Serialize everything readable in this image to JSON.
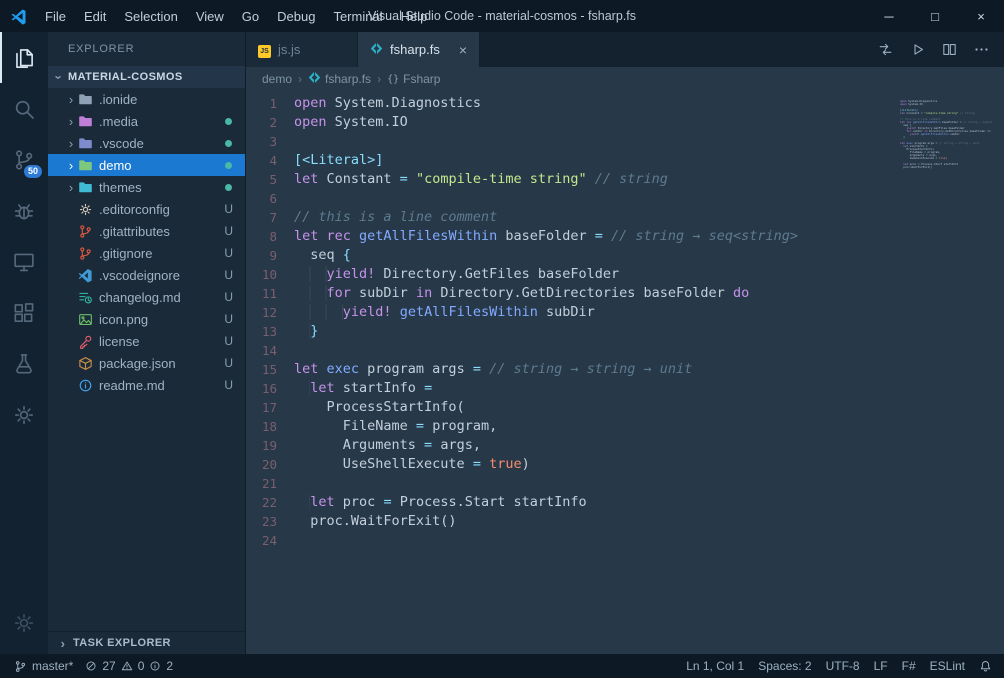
{
  "window": {
    "title": "Visual Studio Code - material-cosmos - fsharp.fs",
    "menus": [
      "File",
      "Edit",
      "Selection",
      "View",
      "Go",
      "Debug",
      "Terminal",
      "Help"
    ],
    "controls": {
      "minimize": "─",
      "maximize": "□",
      "close": "×"
    }
  },
  "activity_bar": {
    "top": [
      {
        "name": "explorer",
        "icon": "files",
        "active": true
      },
      {
        "name": "search",
        "icon": "search"
      },
      {
        "name": "source-control",
        "icon": "scm",
        "badge": "50"
      },
      {
        "name": "debug",
        "icon": "debug"
      },
      {
        "name": "remote-explorer",
        "icon": "remote"
      },
      {
        "name": "extensions",
        "icon": "extensions"
      },
      {
        "name": "test-explorer",
        "icon": "flask"
      },
      {
        "name": "settings",
        "icon": "gear"
      }
    ],
    "bottom": [
      {
        "name": "manage",
        "icon": "gear",
        "dim": true
      }
    ]
  },
  "explorer": {
    "header": "EXPLORER",
    "root": "MATERIAL-COSMOS",
    "bottom_panel": "TASK EXPLORER",
    "items": [
      {
        "kind": "folder",
        "label": ".ionide",
        "color": "#8fa2b5"
      },
      {
        "kind": "folder",
        "label": ".media",
        "color": "#c07fd6",
        "dot": true
      },
      {
        "kind": "folder",
        "label": ".vscode",
        "color": "#7e8ccd",
        "dot": true
      },
      {
        "kind": "folder",
        "label": "demo",
        "color": "#7ec77f",
        "dot": true,
        "selected": true
      },
      {
        "kind": "folder",
        "label": "themes",
        "color": "#3fbcd4",
        "dot": true
      },
      {
        "kind": "file",
        "label": ".editorconfig",
        "icon": "gearfile",
        "color": "#d3cbb7",
        "badge": "U"
      },
      {
        "kind": "file",
        "label": ".gitattributes",
        "icon": "git",
        "color": "#e0593f",
        "badge": "U"
      },
      {
        "kind": "file",
        "label": ".gitignore",
        "icon": "git",
        "color": "#e0593f",
        "badge": "U"
      },
      {
        "kind": "file",
        "label": ".vscodeignore",
        "icon": "vscode",
        "color": "#3f9bd8",
        "badge": "U"
      },
      {
        "kind": "file",
        "label": "changelog.md",
        "icon": "changelog",
        "color": "#2fb3a0",
        "badge": "U"
      },
      {
        "kind": "file",
        "label": "icon.png",
        "icon": "image",
        "color": "#6abf69",
        "badge": "U"
      },
      {
        "kind": "file",
        "label": "license",
        "icon": "key",
        "color": "#ec5f6e",
        "badge": "U"
      },
      {
        "kind": "file",
        "label": "package.json",
        "icon": "npm",
        "color": "#c98f47",
        "badge": "U"
      },
      {
        "kind": "file",
        "label": "readme.md",
        "icon": "info",
        "color": "#42a5f5",
        "badge": "U"
      }
    ]
  },
  "tabs": [
    {
      "label": "js.js",
      "icon": "js",
      "active": false
    },
    {
      "label": "fsharp.fs",
      "icon": "fsharp",
      "active": true,
      "closable": true
    }
  ],
  "editor_actions": [
    {
      "name": "open-changes",
      "icon": "compare"
    },
    {
      "name": "run-code",
      "icon": "run"
    },
    {
      "name": "split-editor",
      "icon": "split"
    },
    {
      "name": "more-actions",
      "icon": "more"
    }
  ],
  "breadcrumb": [
    {
      "label": "demo"
    },
    {
      "label": "fsharp.fs",
      "icon": "fsharp"
    },
    {
      "label": "Fsharp",
      "icon": "namespace"
    }
  ],
  "editor": {
    "lines": [
      [
        [
          "k",
          "open"
        ],
        [
          "v",
          " System.Diagnostics"
        ]
      ],
      [
        [
          "k",
          "open"
        ],
        [
          "v",
          " System.IO"
        ]
      ],
      [],
      [
        [
          "o",
          "[<Literal>]"
        ]
      ],
      [
        [
          "k",
          "let"
        ],
        [
          "v",
          " Constant "
        ],
        [
          "o",
          "="
        ],
        [
          "s",
          " \"compile-time string\""
        ],
        [
          "c",
          " // string"
        ]
      ],
      [],
      [
        [
          "c",
          "// this is a line comment"
        ]
      ],
      [
        [
          "k",
          "let rec"
        ],
        [
          "f",
          " getAllFilesWithin"
        ],
        [
          "v",
          " baseFolder "
        ],
        [
          "o",
          "="
        ],
        [
          "c",
          " // string → seq<string>"
        ]
      ],
      [
        [
          "v",
          "  seq "
        ],
        [
          "o",
          "{"
        ]
      ],
      [
        [
          "v",
          "    "
        ],
        [
          "k",
          "yield!"
        ],
        [
          "v",
          " Directory.GetFiles baseFolder"
        ]
      ],
      [
        [
          "v",
          "    "
        ],
        [
          "k",
          "for"
        ],
        [
          "v",
          " subDir "
        ],
        [
          "k",
          "in"
        ],
        [
          "v",
          " Directory.GetDirectories baseFolder "
        ],
        [
          "k",
          "do"
        ]
      ],
      [
        [
          "v",
          "      "
        ],
        [
          "k",
          "yield!"
        ],
        [
          "f",
          " getAllFilesWithin"
        ],
        [
          "v",
          " subDir"
        ]
      ],
      [
        [
          "v",
          "  "
        ],
        [
          "o",
          "}"
        ]
      ],
      [],
      [
        [
          "k",
          "let"
        ],
        [
          "f",
          " exec"
        ],
        [
          "v",
          " program args "
        ],
        [
          "o",
          "="
        ],
        [
          "c",
          " // string → string → unit"
        ]
      ],
      [
        [
          "v",
          "  "
        ],
        [
          "k",
          "let"
        ],
        [
          "v",
          " startInfo "
        ],
        [
          "o",
          "="
        ]
      ],
      [
        [
          "v",
          "    ProcessStartInfo("
        ]
      ],
      [
        [
          "v",
          "      FileName "
        ],
        [
          "o",
          "="
        ],
        [
          "v",
          " program,"
        ]
      ],
      [
        [
          "v",
          "      Arguments "
        ],
        [
          "o",
          "="
        ],
        [
          "v",
          " args,"
        ]
      ],
      [
        [
          "v",
          "      UseShellExecute "
        ],
        [
          "o",
          "="
        ],
        [
          "n",
          " true"
        ],
        [
          "v",
          ")"
        ]
      ],
      [],
      [
        [
          "v",
          "  "
        ],
        [
          "k",
          "let"
        ],
        [
          "v",
          " proc "
        ],
        [
          "o",
          "="
        ],
        [
          "v",
          " Process.Start startInfo"
        ]
      ],
      [
        [
          "v",
          "  proc.WaitForExit()"
        ]
      ],
      []
    ]
  },
  "status_bar": {
    "left": [
      {
        "name": "git-branch",
        "icon": "branch",
        "label": "master*"
      },
      {
        "name": "problems",
        "parts": [
          {
            "icon": "error",
            "label": "27"
          },
          {
            "icon": "warning",
            "label": "0"
          },
          {
            "icon": "info",
            "label": "2"
          }
        ]
      }
    ],
    "right": [
      {
        "name": "cursor-position",
        "label": "Ln 1, Col 1"
      },
      {
        "name": "indentation",
        "label": "Spaces: 2"
      },
      {
        "name": "encoding",
        "label": "UTF-8"
      },
      {
        "name": "eol",
        "label": "LF"
      },
      {
        "name": "language-mode",
        "label": "F#"
      },
      {
        "name": "eslint",
        "label": "ESLint"
      },
      {
        "name": "notifications",
        "icon": "bell"
      }
    ]
  },
  "colors": {
    "accent_selection": "#1b79d2",
    "scm_badge": "#2e7bd6",
    "modified_dot": "#49b8a4",
    "untracked_badge": "#84a0ac",
    "fsharp_icon": "#2bb5c9",
    "js_icon": "#ffca28"
  }
}
